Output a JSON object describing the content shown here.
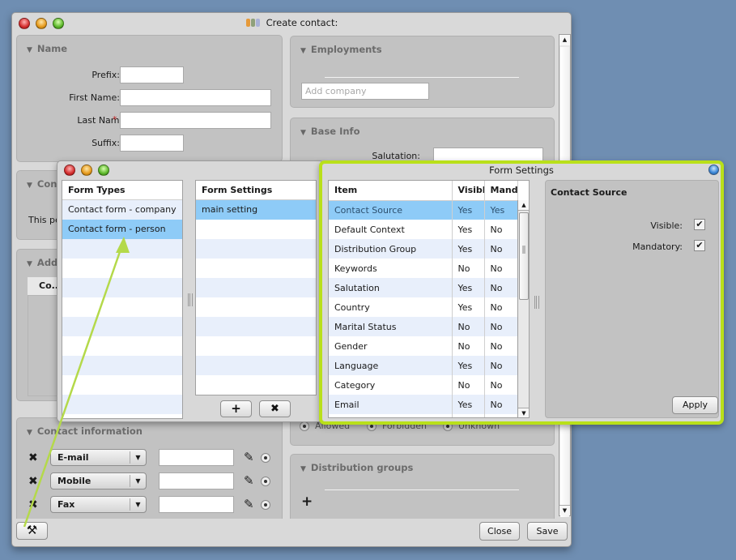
{
  "main_window": {
    "title": "Create contact:",
    "name_section": {
      "title": "Name",
      "fields": [
        {
          "label": "Prefix:",
          "value": "",
          "required": false
        },
        {
          "label": "First Name:",
          "value": "",
          "required": false
        },
        {
          "label": "Last Name:",
          "value": "",
          "required": true
        },
        {
          "label": "Suffix:",
          "value": "",
          "required": false
        }
      ],
      "required_marker": "*"
    },
    "employments_section": {
      "title": "Employments",
      "add_company_placeholder": "Add company"
    },
    "base_info_section": {
      "title": "Base Info",
      "salutation_label": "Salutation:",
      "salutation_value": ""
    },
    "contact_section": {
      "title_partial": "Con",
      "text_partial": "This pe"
    },
    "address_section": {
      "title_partial": "Add",
      "tab_label": "Co..."
    },
    "contact_information_section": {
      "title": "Contact information",
      "rows": [
        {
          "type": "E-mail",
          "value": ""
        },
        {
          "type": "Mobile",
          "value": ""
        },
        {
          "type": "Fax",
          "value": ""
        }
      ]
    },
    "permission_radios": [
      "Allowed",
      "Forbidden",
      "Unknown"
    ],
    "distribution_groups_section": {
      "title": "Distribution groups",
      "add_label": "+"
    },
    "buttons": {
      "close": "Close",
      "save": "Save"
    }
  },
  "form_types_window": {
    "form_types": {
      "header": "Form Types",
      "items": [
        "Contact form - company",
        "Contact form - person"
      ],
      "selected_index": 1
    },
    "form_settings": {
      "header": "Form Settings",
      "items": [
        "main setting"
      ],
      "selected_index": 0
    },
    "add_button": "+",
    "remove_button": "✖"
  },
  "form_settings_window": {
    "title": "Form Settings",
    "columns": [
      "Item",
      "Visible",
      "Mand"
    ],
    "rows": [
      {
        "item": "Contact Source",
        "visible": "Yes",
        "mandatory": "Yes"
      },
      {
        "item": "Default Context",
        "visible": "Yes",
        "mandatory": "No"
      },
      {
        "item": "Distribution Group",
        "visible": "Yes",
        "mandatory": "No"
      },
      {
        "item": "Keywords",
        "visible": "No",
        "mandatory": "No"
      },
      {
        "item": "Salutation",
        "visible": "Yes",
        "mandatory": "No"
      },
      {
        "item": "Country",
        "visible": "Yes",
        "mandatory": "No"
      },
      {
        "item": "Marital Status",
        "visible": "No",
        "mandatory": "No"
      },
      {
        "item": "Gender",
        "visible": "No",
        "mandatory": "No"
      },
      {
        "item": "Language",
        "visible": "Yes",
        "mandatory": "No"
      },
      {
        "item": "Category",
        "visible": "No",
        "mandatory": "No"
      },
      {
        "item": "Email",
        "visible": "Yes",
        "mandatory": "No"
      }
    ],
    "selected_index": 0,
    "detail": {
      "title": "Contact Source",
      "visible_label": "Visible:",
      "visible_checked": true,
      "mandatory_label": "Mandatory:",
      "mandatory_checked": true,
      "apply": "Apply"
    }
  },
  "colors": {
    "highlight_border": "#b9e01a",
    "selection": "#8ecbf7",
    "desktop": "#6f8eb2",
    "required": "#c0282a"
  }
}
